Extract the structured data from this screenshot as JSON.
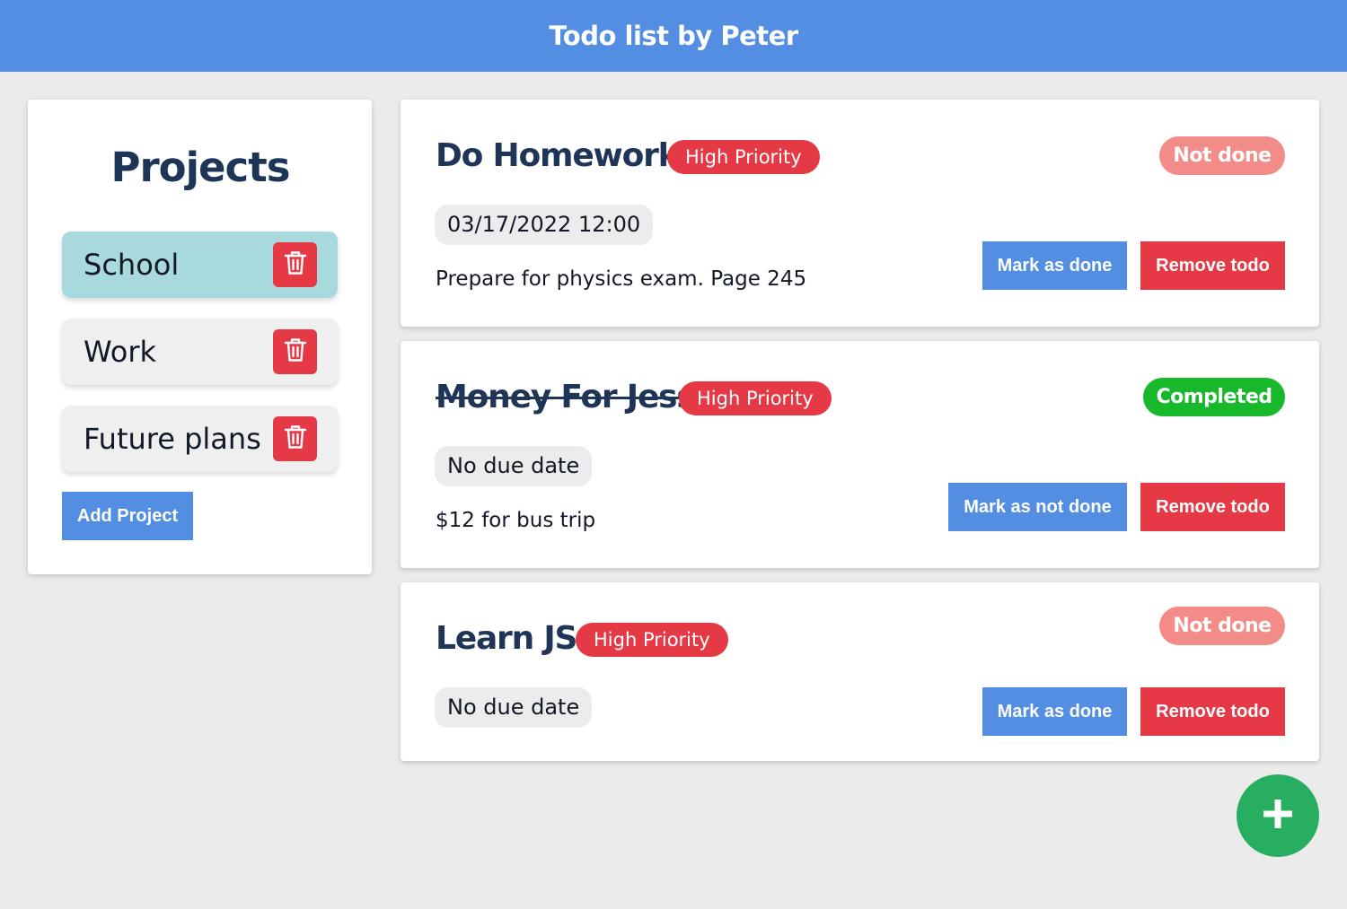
{
  "header": {
    "title": "Todo list by Peter"
  },
  "projects": {
    "title": "Projects",
    "items": [
      {
        "label": "School"
      },
      {
        "label": "Work"
      },
      {
        "label": "Future plans"
      }
    ],
    "add_label": "Add Project"
  },
  "todos": [
    {
      "title": "Do Homework",
      "priority": "High Priority",
      "status": "Not done",
      "due": "03/17/2022 12:00",
      "description": "Prepare for physics exam. Page 245",
      "toggle_label": "Mark as done",
      "remove_label": "Remove todo"
    },
    {
      "title": "Money For Jess",
      "priority": "High Priority",
      "status": "Completed",
      "due": "No due date",
      "description": "$12 for bus trip",
      "toggle_label": "Mark as not done",
      "remove_label": "Remove todo"
    },
    {
      "title": "Learn JS",
      "priority": "High Priority",
      "status": "Not done",
      "due": "No due date",
      "toggle_label": "Mark as done",
      "remove_label": "Remove todo"
    }
  ],
  "colors": {
    "header": "#538ee3",
    "danger": "#e63946",
    "not_done": "#f38b89",
    "completed": "#18b82b",
    "fab": "#27ae60",
    "active_project": "#a8d9dc"
  },
  "icons": {
    "delete": "trash-icon",
    "add": "plus-icon"
  }
}
